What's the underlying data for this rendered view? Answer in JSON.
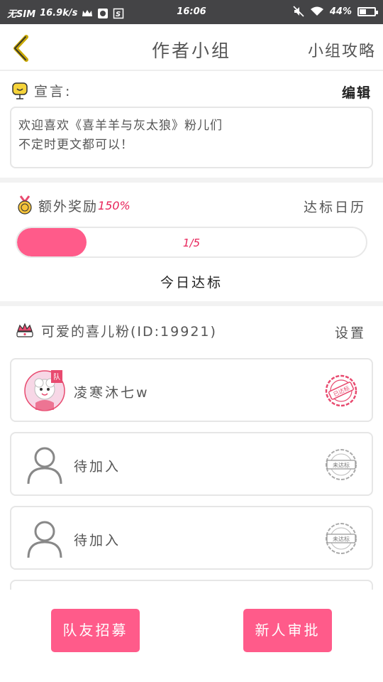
{
  "status_bar": {
    "carrier": "无SIM",
    "speed": "16.9k/s",
    "time": "16:06",
    "battery": "44%"
  },
  "nav": {
    "title": "作者小组",
    "right_link": "小组攻略"
  },
  "declaration": {
    "label": "宣言:",
    "edit": "编辑",
    "line1": "欢迎喜欢《喜羊羊与灰太狼》粉儿们",
    "line2": "不定时更文都可以！"
  },
  "reward": {
    "label": "额外奖励",
    "percent": "150%",
    "calendar": "达标日历",
    "progress_text": "1/5",
    "progress_fraction": 0.2,
    "today": "今日达标"
  },
  "team": {
    "name": "可爱的喜儿粉(ID:19921)",
    "settings": "设置",
    "captain_badge": "队",
    "members": [
      {
        "name": "凌寒沐七w",
        "stamp": "已达标",
        "status": "done"
      },
      {
        "name": "待加入",
        "stamp": "未达标",
        "status": "pending"
      },
      {
        "name": "待加入",
        "stamp": "未达标",
        "status": "pending"
      }
    ]
  },
  "buttons": {
    "recruit": "队友招募",
    "approve": "新人审批"
  },
  "colors": {
    "accent": "#ff5b8a",
    "accent_text": "#e8245a"
  }
}
